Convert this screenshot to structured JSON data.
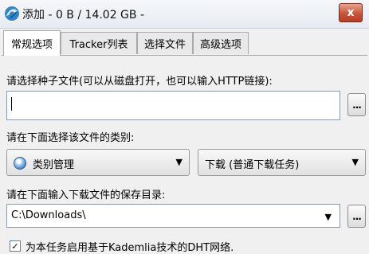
{
  "window": {
    "title": "添加 - 0 B / 14.02 GB -",
    "close_label": "x"
  },
  "tabs": [
    {
      "label": "常规选项",
      "active": true
    },
    {
      "label": "Tracker列表",
      "active": false
    },
    {
      "label": "选择文件",
      "active": false
    },
    {
      "label": "高级选项",
      "active": false
    }
  ],
  "torrent": {
    "prompt": "请选择种子文件(可以从磁盘打开，也可以输入HTTP链接):",
    "value": "",
    "browse_label": "..."
  },
  "category": {
    "prompt": "请在下面选择该文件的类别:",
    "category_value": "类别管理",
    "download_type_value": "下载 (普通下载任务)",
    "arrow": "▼"
  },
  "save_dir": {
    "prompt": "请在下面输入下载文件的保存目录:",
    "value": "C:\\Downloads\\",
    "browse_label": "...",
    "arrow": "▼"
  },
  "dht": {
    "label": "为本任务启用基于Kademlia技术的DHT网络.",
    "checked": true,
    "check_mark": "✓"
  },
  "icons": {
    "app": "app-icon",
    "category": "category-icon"
  },
  "colors": {
    "close_button": "#c9543a",
    "titlebar": "#e7ebf1"
  }
}
